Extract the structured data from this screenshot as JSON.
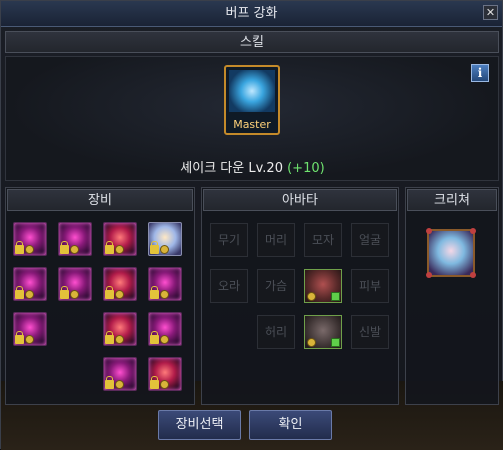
{
  "window": {
    "title": "버프 강화",
    "close_label": "✕"
  },
  "skill_section": {
    "header": "스킬",
    "info_label": "i",
    "icon_tag": "Master",
    "skill_name": "셰이크 다운 Lv.20",
    "skill_bonus": "(+10)"
  },
  "equipment": {
    "header": "장비"
  },
  "avatar": {
    "header": "아바타",
    "slots": {
      "weapon": "무기",
      "hair": "머리",
      "hat": "모자",
      "face": "얼굴",
      "aura": "오라",
      "chest": "가슴",
      "skin": "피부",
      "waist": "허리",
      "shoes": "신발"
    }
  },
  "creature": {
    "header": "크리쳐"
  },
  "buttons": {
    "select_equipment": "장비선택",
    "confirm": "확인"
  },
  "colors": {
    "title_bar": "#2a3850",
    "bonus_text": "#6fe36f",
    "master_frame": "#c48a2a"
  }
}
